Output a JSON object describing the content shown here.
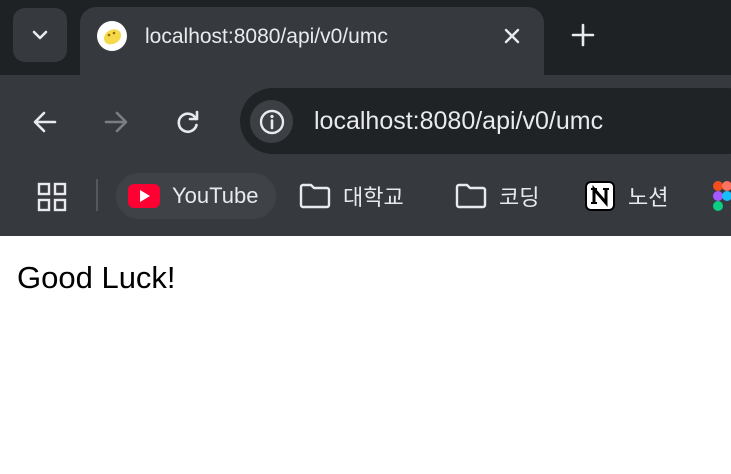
{
  "tab": {
    "title": "localhost:8080/api/v0/umc"
  },
  "toolbar": {
    "url": "localhost:8080/api/v0/umc"
  },
  "bookmarks": [
    {
      "label": "YouTube",
      "icon": "youtube-icon"
    },
    {
      "label": "대학교",
      "icon": "folder-icon"
    },
    {
      "label": "코딩",
      "icon": "folder-icon"
    },
    {
      "label": "노션",
      "icon": "notion-icon"
    }
  ],
  "page": {
    "text": "Good Luck!"
  },
  "colors": {
    "tab_strip": "#1f2225",
    "toolbar": "#36393e",
    "omnibox": "#202326",
    "youtube_red": "#ff0033"
  }
}
